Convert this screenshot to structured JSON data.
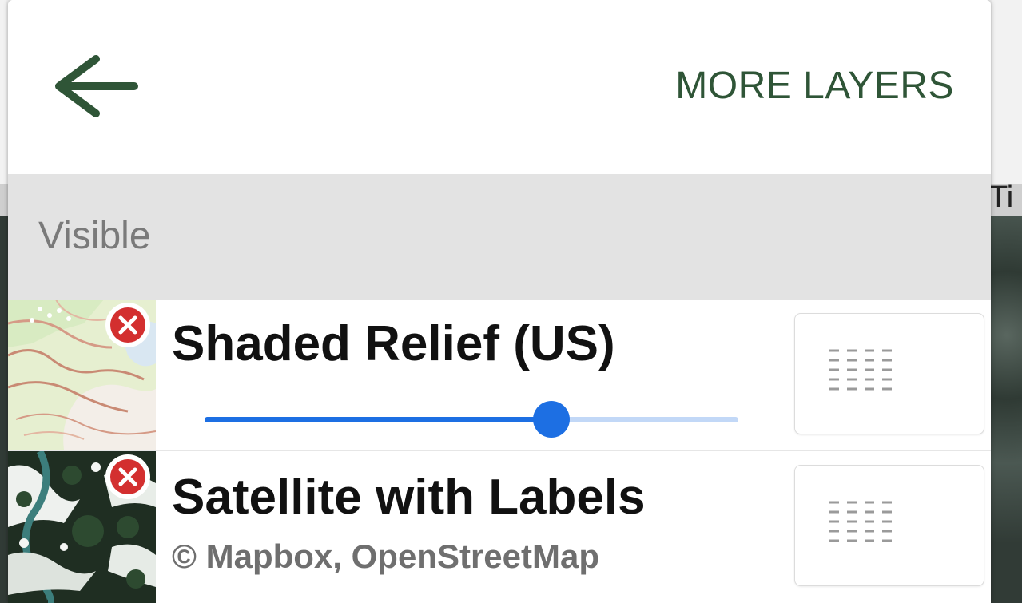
{
  "background": {
    "partial_text": "Ti"
  },
  "header": {
    "back_icon": "arrow-left-icon",
    "more_layers_label": "MORE LAYERS",
    "accent_color": "#2f5537"
  },
  "section": {
    "title": "Visible"
  },
  "layers": [
    {
      "name": "Shaded Relief (US)",
      "thumbnail": "topographic-map",
      "opacity": 0.65,
      "remove_icon": "close-circle-icon",
      "handle_icon": "grip-icon"
    },
    {
      "name": "Satellite with Labels",
      "attribution": "© Mapbox, OpenStreetMap",
      "thumbnail": "satellite-imagery",
      "remove_icon": "close-circle-icon",
      "handle_icon": "grip-icon"
    }
  ],
  "colors": {
    "slider": "#1d6fe3",
    "slider_track": "#c2d8f7",
    "remove": "#d32f2f",
    "section_bg": "#e3e3e3"
  }
}
